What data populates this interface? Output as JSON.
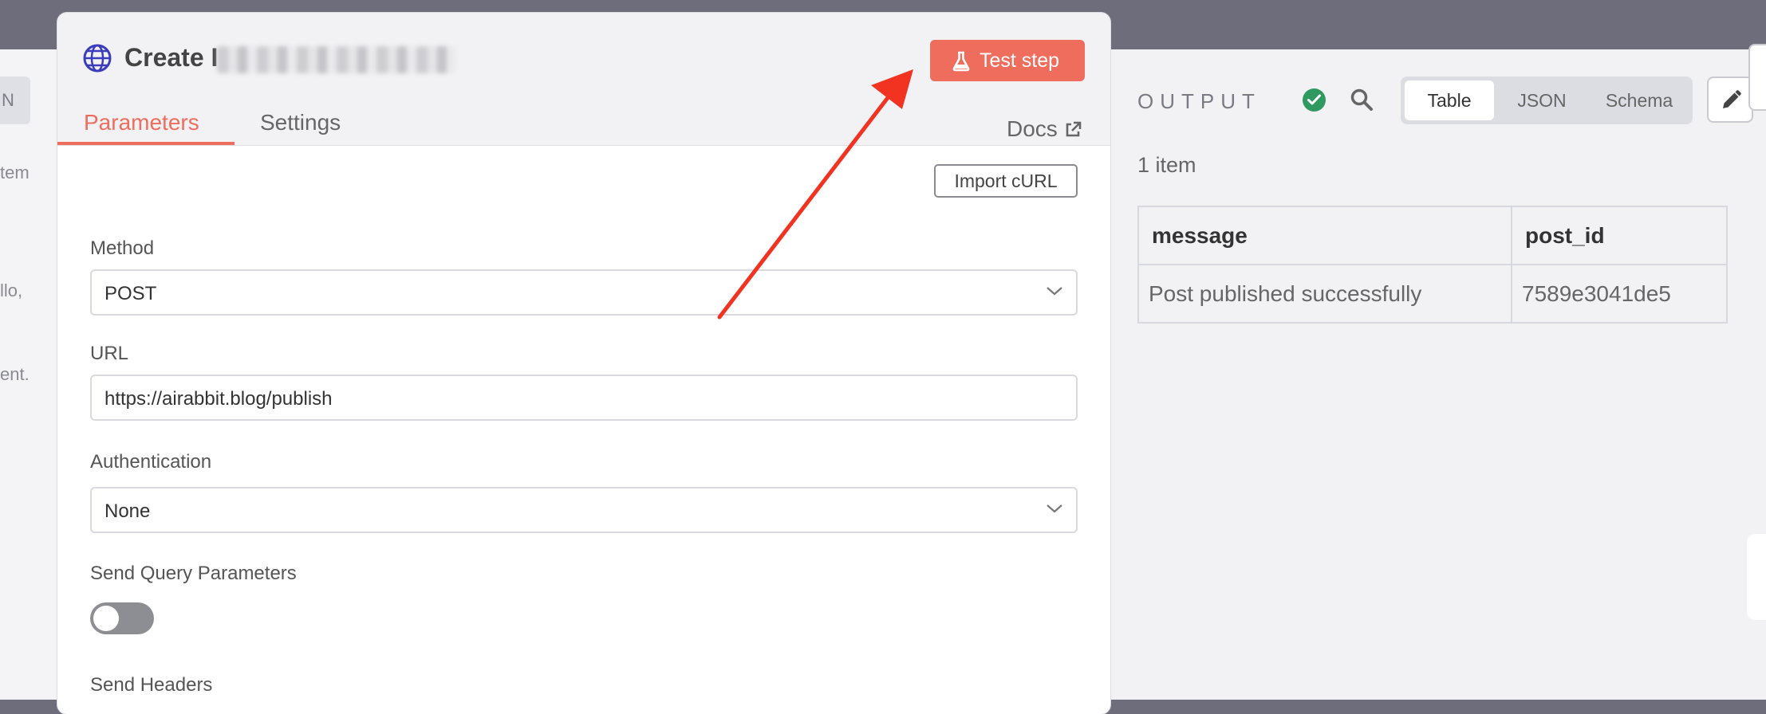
{
  "left_panel": {
    "button_fragment": "N",
    "text_fragments": [
      "tem",
      "llo,",
      "ent."
    ]
  },
  "node": {
    "title": "Create I",
    "test_step_label": "Test step",
    "tabs": [
      {
        "label": "Parameters",
        "active": true
      },
      {
        "label": "Settings",
        "active": false
      }
    ],
    "docs_label": "Docs",
    "import_curl_label": "Import cURL",
    "fields": {
      "method": {
        "label": "Method",
        "value": "POST"
      },
      "url": {
        "label": "URL",
        "value": "https://airabbit.blog/publish"
      },
      "authentication": {
        "label": "Authentication",
        "value": "None"
      },
      "send_query_parameters": {
        "label": "Send Query Parameters",
        "enabled": false
      },
      "send_headers": {
        "label": "Send Headers"
      }
    }
  },
  "output": {
    "title": "OUTPUT",
    "status": "success",
    "view_options": [
      {
        "label": "Table",
        "active": true
      },
      {
        "label": "JSON",
        "active": false
      },
      {
        "label": "Schema",
        "active": false
      }
    ],
    "item_count": "1 item",
    "table": {
      "columns": [
        "message",
        "post_id"
      ],
      "rows": [
        [
          "Post published successfully",
          "7589e3041de5"
        ]
      ]
    }
  },
  "icons": [
    "globe-icon",
    "flask-icon",
    "external-link-icon",
    "chevron-down-icon",
    "check-circle-icon",
    "search-icon",
    "pencil-icon",
    "pin-icon"
  ],
  "colors": {
    "accent": "#ef6d5c",
    "success": "#2f9a5f",
    "backdrop": "#6e6d7b",
    "globe": "#3b3bbd",
    "annotation": "#f23322"
  }
}
